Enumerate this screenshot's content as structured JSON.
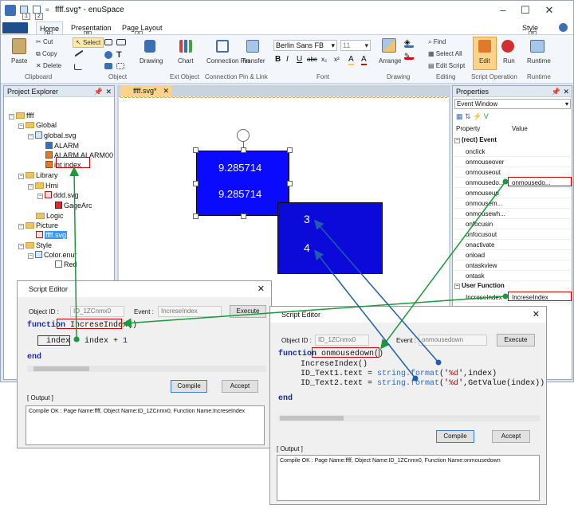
{
  "window": {
    "title": "ffff.svg* - enuSpace",
    "style_label": "Style",
    "quick_access": [
      "1",
      "2"
    ],
    "keytip_style": "S"
  },
  "ribbon_tabs": [
    {
      "label": "Home",
      "keytip": "H"
    },
    {
      "label": "Presentation",
      "keytip": "P"
    },
    {
      "label": "Page Layout",
      "keytip": "A"
    }
  ],
  "ribbon": {
    "paste": "Paste",
    "cut": "Cut",
    "copy": "Copy",
    "delete": "Delete",
    "clipboard": "Clipboard",
    "select": "Select",
    "object": "Object",
    "drawing": "Drawing",
    "chart": "Chart",
    "ext_object": "Ext Object",
    "connection_pin": "Connection Pin",
    "transfer": "Transfer",
    "connection_group": "Connection Pin & Link",
    "font_name": "Berlin Sans FB",
    "font_size": "11",
    "font": "Font",
    "arrange": "Arrange",
    "drawing_group": "Drawing",
    "find": "Find",
    "select_all": "Select All",
    "edit_script": "Edit Script",
    "editing": "Editing",
    "edit": "Edit",
    "run": "Run",
    "script_operation": "Script Operation",
    "runtime": "Runtime",
    "runtime_group": "Runtime",
    "font_btns": [
      "B",
      "I",
      "U",
      "abc",
      "x₂",
      "x²",
      "A",
      "A"
    ]
  },
  "project_explorer": {
    "title": "Project Explorer",
    "items": [
      {
        "label": "ffff"
      },
      {
        "label": "Global"
      },
      {
        "label": "global.svg"
      },
      {
        "label": "ALARM"
      },
      {
        "label": "ALARM ALARM00"
      },
      {
        "label": "int index"
      },
      {
        "label": "Library"
      },
      {
        "label": "Hmi"
      },
      {
        "label": "ddd.svg"
      },
      {
        "label": "GageArc"
      },
      {
        "label": "Logic"
      },
      {
        "label": "Picture"
      },
      {
        "label": "ffff.svg"
      },
      {
        "label": "Style"
      },
      {
        "label": "Color.enur"
      },
      {
        "label": "Red"
      }
    ]
  },
  "document": {
    "tab": "ffff.svg*",
    "rect1": {
      "line1": "9.285714",
      "line2": "9.285714",
      "color": "#0a0aff"
    },
    "rect2": {
      "line1": "3",
      "line2": "4",
      "color": "#0c0ad8"
    }
  },
  "properties": {
    "title": "Properties",
    "dropdown": "Event Window",
    "col_property": "Property",
    "col_value": "Value",
    "section_event": "(rect) Event",
    "events": [
      {
        "name": "onclick",
        "value": ""
      },
      {
        "name": "onmouseover",
        "value": ""
      },
      {
        "name": "onmouseout",
        "value": ""
      },
      {
        "name": "onmousedo...",
        "value": "onmousedo..."
      },
      {
        "name": "onmouseup",
        "value": ""
      },
      {
        "name": "onmousem...",
        "value": ""
      },
      {
        "name": "onmousewh...",
        "value": ""
      },
      {
        "name": "onfocusin",
        "value": ""
      },
      {
        "name": "onfocusout",
        "value": ""
      },
      {
        "name": "onactivate",
        "value": ""
      },
      {
        "name": "onload",
        "value": ""
      },
      {
        "name": "ontaskview",
        "value": ""
      },
      {
        "name": "ontask",
        "value": ""
      }
    ],
    "section_user": "User Function",
    "user_functions": [
      {
        "name": "IncreseIndex",
        "value": "IncreseIndex"
      }
    ]
  },
  "script_editor_1": {
    "title": "Script Editor",
    "object_id_label": "Object ID :",
    "object_id": "ID_1ZCnmx0",
    "event_label": "Event :",
    "event": "IncreseIndex",
    "execute": "Execute",
    "code_fn": "function",
    "code_name": "IncreseIndex()",
    "code_var": "index",
    "code_rest": " = index + ",
    "code_num": "1",
    "code_end": "end",
    "compile": "Compile",
    "accept": "Accept",
    "output_label": "[ Output ]",
    "output": "Compile OK : Page Name:ffff, Object Name:ID_1ZCnmx0, Function Name:IncreseIndex"
  },
  "script_editor_2": {
    "title": "Script Editor",
    "object_id_label": "Object ID :",
    "object_id": "ID_1ZCnmx0",
    "event_label": "Event :",
    "event": "onmousedown",
    "execute": "Execute",
    "code_fn": "function",
    "code_name": "onmousedown()",
    "line1": "IncreseIndex()",
    "line2a": "ID_Text1.text = ",
    "line2b": "string.format",
    "line2c": "('",
    "line2d": "%d",
    "line2e": "',index)",
    "line3a": "ID_Text2.text = ",
    "line3b": "string.format",
    "line3c": "('",
    "line3d": "%d",
    "line3e": "',GetValue(index))",
    "code_end": "end",
    "compile": "Compile",
    "accept": "Accept",
    "output_label": "[ Output ]",
    "output": "Compile OK : Page Name:ffff, Object Name:ID_1ZCnmx0, Function Name:onmousedown"
  },
  "colors": {
    "highlight_red": "#d00000",
    "arrow_green": "#1a9a3a",
    "arrow_blue": "#1f5fa8"
  }
}
